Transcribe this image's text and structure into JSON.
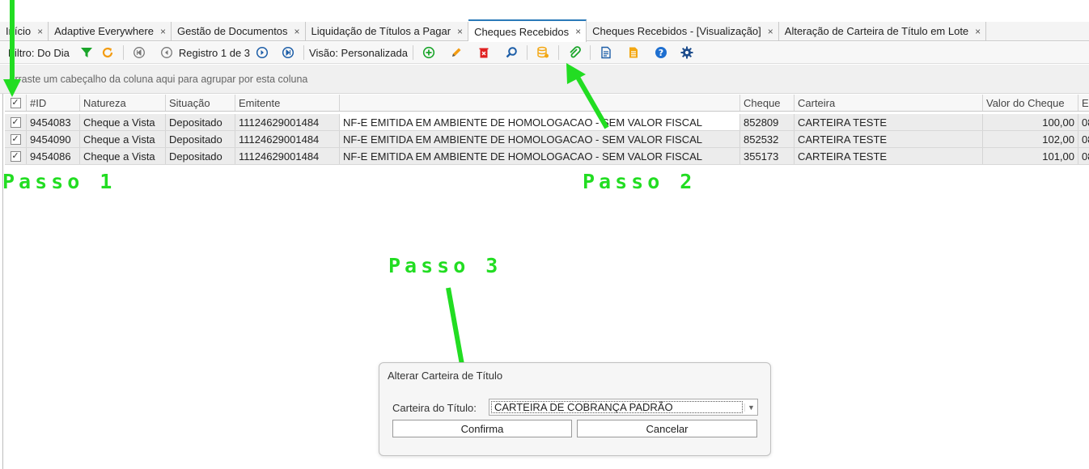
{
  "tabs": [
    {
      "label": "Início",
      "active": false
    },
    {
      "label": "Adaptive Everywhere",
      "active": false
    },
    {
      "label": "Gestão de Documentos",
      "active": false
    },
    {
      "label": "Liquidação de Títulos a Pagar",
      "active": false
    },
    {
      "label": "Cheques Recebidos",
      "active": true
    },
    {
      "label": "Cheques Recebidos - [Visualização]",
      "active": false
    },
    {
      "label": "Alteração de Carteira de Título em Lote",
      "active": false
    }
  ],
  "tab_close_glyph": "×",
  "toolbar": {
    "filter_label": "Filtro: Do Dia",
    "record_label": "Registro 1 de 3",
    "view_label": "Visão: Personalizada",
    "icons": [
      "filter-icon",
      "refresh-icon",
      "first-record-icon",
      "previous-record-icon",
      "next-record-icon",
      "last-record-icon",
      "add-icon",
      "edit-icon",
      "delete-icon",
      "search-icon",
      "change-portfolio-icon",
      "attach-icon",
      "report-icon",
      "document-icon",
      "help-icon",
      "settings-icon"
    ]
  },
  "group_hint": "Arraste um cabeçalho da coluna aqui para agrupar por esta coluna",
  "grid": {
    "columns": [
      "#ID",
      "Natureza",
      "Situação",
      "Emitente",
      "",
      "Cheque",
      "Carteira",
      "Valor do Cheque",
      "Er"
    ],
    "rows": [
      {
        "checked": true,
        "id": "9454083",
        "natureza": "Cheque a Vista",
        "situacao": "Depositado",
        "emitente": "11124629001484",
        "descricao": "NF-E EMITIDA EM AMBIENTE DE HOMOLOGACAO - SEM VALOR FISCAL",
        "cheque": "852809",
        "carteira": "CARTEIRA TESTE",
        "valor": "100,00",
        "extra": "08"
      },
      {
        "checked": true,
        "id": "9454090",
        "natureza": "Cheque a Vista",
        "situacao": "Depositado",
        "emitente": "11124629001484",
        "descricao": "NF-E EMITIDA EM AMBIENTE DE HOMOLOGACAO - SEM VALOR FISCAL",
        "cheque": "852532",
        "carteira": "CARTEIRA TESTE",
        "valor": "102,00",
        "extra": "08"
      },
      {
        "checked": true,
        "id": "9454086",
        "natureza": "Cheque a Vista",
        "situacao": "Depositado",
        "emitente": "11124629001484",
        "descricao": "NF-E EMITIDA EM AMBIENTE DE HOMOLOGACAO - SEM VALOR FISCAL",
        "cheque": "355173",
        "carteira": "CARTEIRA TESTE",
        "valor": "101,00",
        "extra": "08"
      }
    ]
  },
  "annotations": {
    "step1": "Passo 1",
    "step2": "Passo 2",
    "step3": "Passo 3"
  },
  "dialog": {
    "title": "Alterar Carteira de Título",
    "field_label": "Carteira do Título:",
    "field_value": "CARTEIRA DE COBRANÇA PADRÃO",
    "confirm_label": "Confirma",
    "cancel_label": "Cancelar"
  },
  "colors": {
    "annotation": "#22dd22",
    "accent": "#2a7ab8"
  }
}
